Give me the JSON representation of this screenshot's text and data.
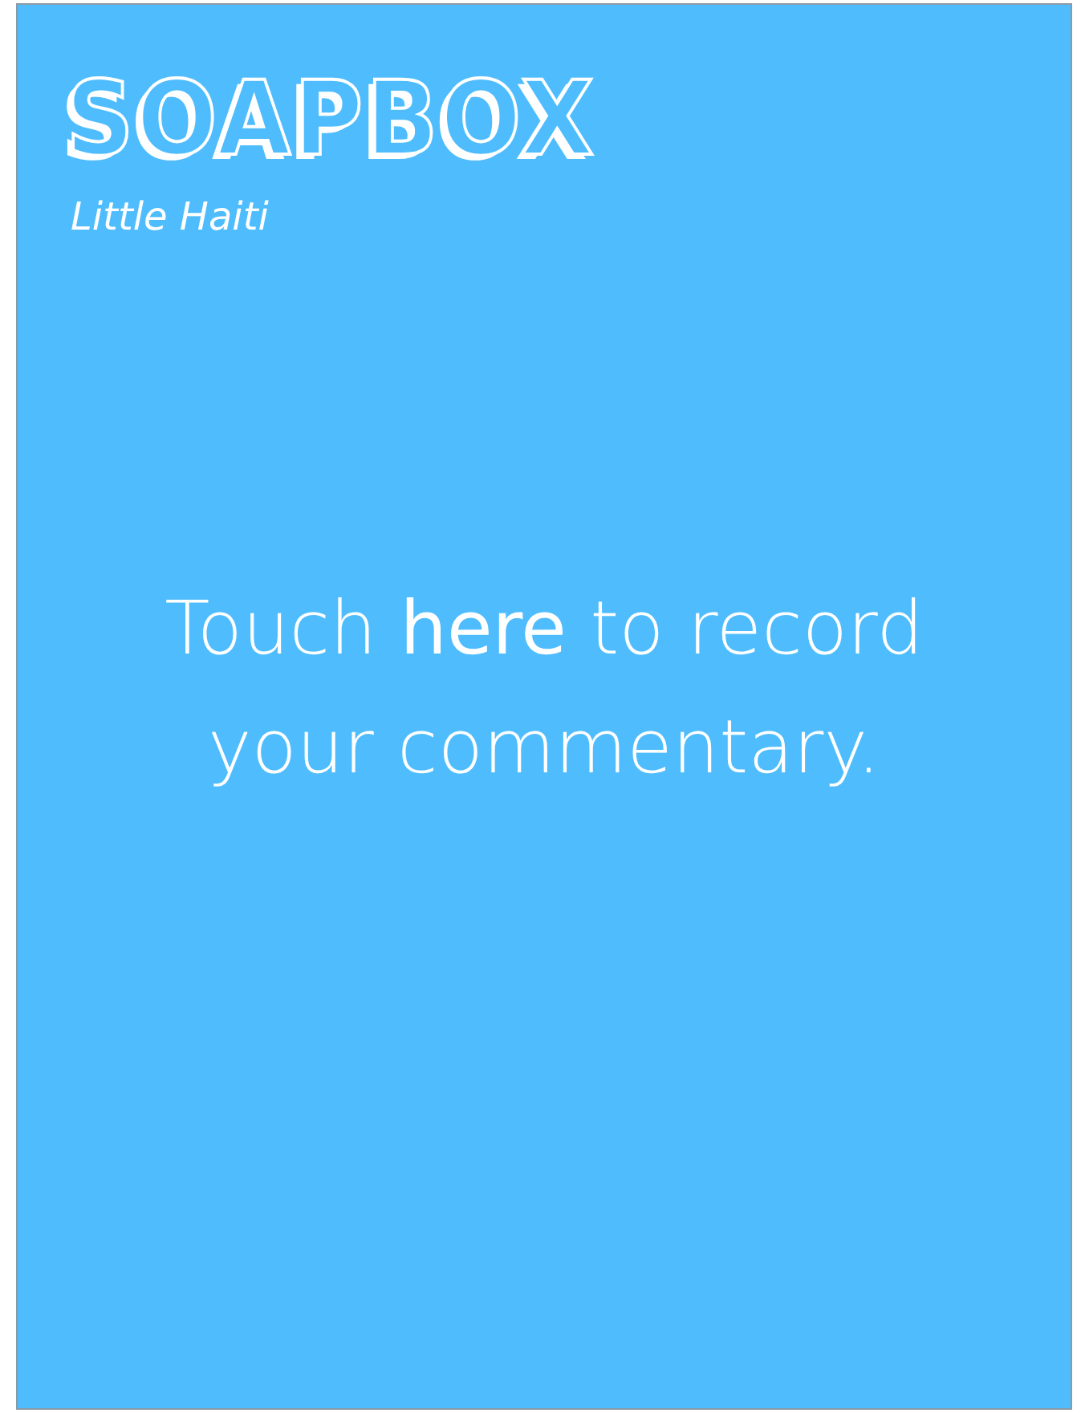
{
  "logo": "SOAPBOX",
  "location": "Little Haiti",
  "prompt": "Touch **here** to record your commentary."
}
